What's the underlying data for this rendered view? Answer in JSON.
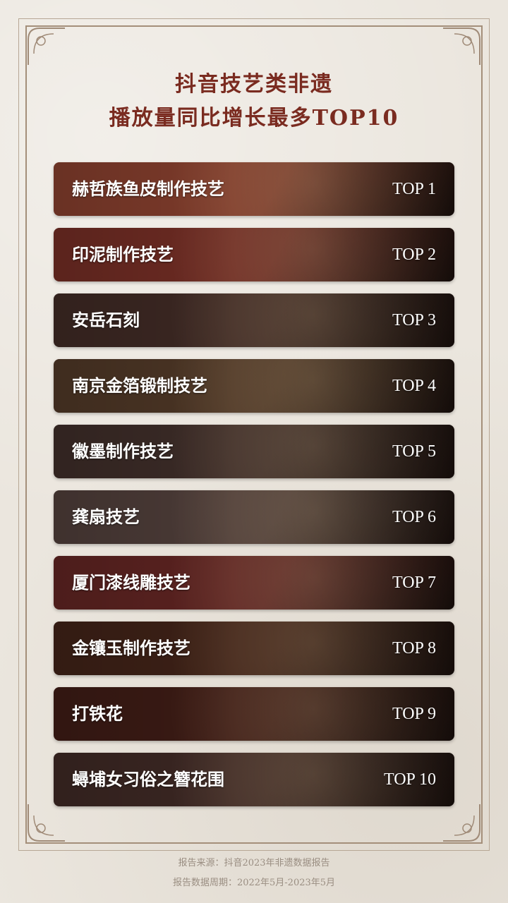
{
  "title": {
    "line1": "抖音技艺类非遗",
    "line2": "播放量同比增长最多TOP10"
  },
  "items": [
    {
      "name": "赫哲族鱼皮制作技艺",
      "rank": "TOP 1"
    },
    {
      "name": "印泥制作技艺",
      "rank": "TOP 2"
    },
    {
      "name": "安岳石刻",
      "rank": "TOP 3"
    },
    {
      "name": "南京金箔锻制技艺",
      "rank": "TOP 4"
    },
    {
      "name": "徽墨制作技艺",
      "rank": "TOP 5"
    },
    {
      "name": "龚扇技艺",
      "rank": "TOP 6"
    },
    {
      "name": "厦门漆线雕技艺",
      "rank": "TOP 7"
    },
    {
      "name": "金镶玉制作技艺",
      "rank": "TOP 8"
    },
    {
      "name": "打铁花",
      "rank": "TOP 9"
    },
    {
      "name": "蟳埔女习俗之簪花围",
      "rank": "TOP 10"
    }
  ],
  "footer": {
    "source": "报告来源：抖音2023年非遗数据报告",
    "period": "报告数据周期：2022年5月-2023年5月"
  },
  "colors": {
    "title": "#7a2b20",
    "frame": "#a48f7a",
    "rows": [
      "#7c3a2a",
      "#6b2a22",
      "#3b2722",
      "#4a3424",
      "#3a2a26",
      "#4a3a36",
      "#5a2220",
      "#3c2016",
      "#3a1a14",
      "#3a2622"
    ]
  }
}
